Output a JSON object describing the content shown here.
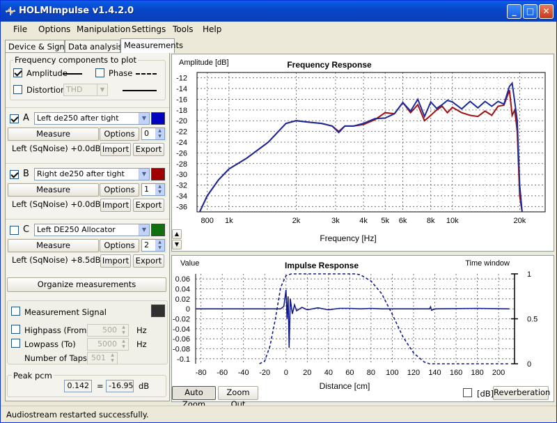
{
  "window": {
    "title": "HOLMImpulse  v1.4.2.0",
    "minimize": "_",
    "maximize": "□",
    "close": "✕"
  },
  "menu": [
    "File",
    "Options",
    "Manipulation",
    "Settings",
    "Tools",
    "Help"
  ],
  "tabs": [
    "Device & Signal",
    "Data analysis",
    "Measurements"
  ],
  "components": {
    "group_label": "Frequency components to plot",
    "amplitude": "Amplitude",
    "phase": "Phase",
    "distortion": "Distortion",
    "distortion_type": "THD",
    "amplitude_checked": true,
    "phase_checked": false,
    "distortion_checked": false
  },
  "measurements": [
    {
      "letter": "A",
      "name": "Left de250 after tight",
      "color": "#0000c0",
      "checked": true,
      "measure": "Measure",
      "options": "Options",
      "index": "0",
      "status": "Left (SqNoise) +0.0dB",
      "import": "Import",
      "export": "Export"
    },
    {
      "letter": "B",
      "name": "Right de250 after tight",
      "color": "#a00000",
      "checked": true,
      "measure": "Measure",
      "options": "Options",
      "index": "1",
      "status": "Left (SqNoise) +0.0dB",
      "import": "Import",
      "export": "Export"
    },
    {
      "letter": "C",
      "name": "Left DE250 Allocator",
      "color": "#107010",
      "checked": false,
      "measure": "Measure",
      "options": "Options",
      "index": "2",
      "status": "Left (SqNoise) +8.5dB",
      "import": "Import",
      "export": "Export"
    }
  ],
  "organize": "Organize measurements",
  "signal": {
    "label": "Measurement Signal",
    "color": "#303030",
    "highpass": "Highpass (From)",
    "highpass_value": "500",
    "hz1": "Hz",
    "lowpass": "Lowpass (To)",
    "lowpass_value": "5000",
    "hz2": "Hz",
    "taps_label": "Number of Taps",
    "taps_value": "501"
  },
  "peak": {
    "label": "Peak pcm",
    "value1": "0.142",
    "eq": "=",
    "value2": "-16.95",
    "unit": "dB"
  },
  "freq_plot": {
    "ylabel": "Amplitude [dB]",
    "title": "Frequency Response",
    "xlabel": "Frequency [Hz]",
    "yticks": [
      "-12",
      "-14",
      "-16",
      "-18",
      "-20",
      "-22",
      "-24",
      "-26",
      "-28",
      "-30",
      "-32",
      "-34",
      "-36"
    ],
    "xticks": [
      "800",
      "1k",
      "2k",
      "3k",
      "4k",
      "5k",
      "6k",
      "8k",
      "10k",
      "20k"
    ]
  },
  "imp_plot": {
    "ylabel": "Value",
    "title": "Impulse Response",
    "rlabel": "Time window",
    "xlabel": "Distance [cm]",
    "yticks": [
      "0.06",
      "0.04",
      "0.02",
      "0",
      "-0.02",
      "-0.04",
      "-0.06",
      "-0.08",
      "-0.1"
    ],
    "rticks": [
      "1",
      "0.5",
      "0"
    ],
    "xticks": [
      "-80",
      "-60",
      "-40",
      "-20",
      "0",
      "20",
      "40",
      "60",
      "80",
      "100",
      "120",
      "140",
      "160",
      "180",
      "200"
    ]
  },
  "controls": {
    "auto_zoom": "Auto Zoom",
    "zoom_out": "Zoom Out",
    "db": "[dB]",
    "reverb": "Reverberation",
    "up": "▲",
    "down": "▼"
  },
  "status": "Audiostream restarted successfully.",
  "chart_data": [
    {
      "type": "line",
      "title": "Frequency Response",
      "xlabel": "Frequency [Hz]",
      "ylabel": "Amplitude [dB]",
      "xscale": "log",
      "xlim": [
        720,
        26000
      ],
      "ylim": [
        -37,
        -11
      ],
      "grid": true,
      "series": [
        {
          "color": "#1a2a9c",
          "x": [
            740,
            800,
            900,
            1000,
            1200,
            1500,
            1800,
            2000,
            2300,
            2600,
            2900,
            3100,
            3300,
            3600,
            4000,
            4500,
            5000,
            5500,
            6000,
            6500,
            7000,
            7500,
            8000,
            8500,
            9000,
            9500,
            10000,
            11000,
            12000,
            13000,
            14000,
            15000,
            16000,
            17000,
            18000,
            18500,
            19000,
            19500,
            20000,
            20500
          ],
          "y": [
            -37,
            -34,
            -31,
            -29,
            -27,
            -24,
            -20.5,
            -20,
            -20.3,
            -20.5,
            -21,
            -22.2,
            -21,
            -21,
            -20.5,
            -19.6,
            -19.5,
            -18.7,
            -16.6,
            -18.2,
            -16,
            -19.2,
            -16.5,
            -17.7,
            -17,
            -16.2,
            -16.5,
            -17.8,
            -16.4,
            -17.6,
            -16.4,
            -17.3,
            -16.4,
            -16.9,
            -13.6,
            -13,
            -16.5,
            -20,
            -32,
            -37
          ]
        },
        {
          "color": "#a01010",
          "x": [
            740,
            800,
            900,
            1000,
            1200,
            1500,
            1800,
            2000,
            2300,
            2600,
            2900,
            3100,
            3300,
            3600,
            4000,
            4500,
            5000,
            5500,
            6000,
            6500,
            7000,
            7500,
            8000,
            8500,
            9000,
            9500,
            10000,
            11000,
            12000,
            13000,
            14000,
            15000,
            16000,
            17000,
            18000,
            18500,
            19000,
            19500,
            20000,
            20500
          ],
          "y": [
            -37,
            -34,
            -31,
            -29,
            -27,
            -24,
            -20.5,
            -20,
            -20.3,
            -20.5,
            -21,
            -22,
            -21,
            -21,
            -20.7,
            -19.8,
            -18.5,
            -18.7,
            -16.6,
            -18.5,
            -17,
            -20,
            -19,
            -18,
            -17.3,
            -18.5,
            -17.5,
            -18.5,
            -19,
            -19.2,
            -18.2,
            -19,
            -17.3,
            -17.1,
            -14.3,
            -19,
            -18,
            -22,
            -34,
            -37
          ]
        }
      ]
    },
    {
      "type": "line",
      "title": "Impulse Response",
      "xlabel": "Distance [cm]",
      "ylabel": "Value",
      "y2label": "Time window",
      "xlim": [
        -85,
        215
      ],
      "ylim": [
        -0.11,
        0.07
      ],
      "y2lim": [
        0,
        1
      ],
      "grid": true,
      "series": [
        {
          "color": "#101a8a",
          "x": [
            -85,
            -5,
            -2,
            0,
            1,
            2,
            3,
            4,
            6,
            8,
            10,
            15,
            20,
            30,
            40,
            50,
            60,
            70,
            80,
            90,
            100,
            135,
            136,
            137,
            140,
            180,
            210
          ],
          "y": [
            0,
            0,
            0.005,
            0.038,
            -0.02,
            0.025,
            -0.078,
            0.02,
            -0.01,
            0.008,
            -0.004,
            0.003,
            -0.002,
            0.002,
            -0.002,
            0.001,
            0.001,
            0,
            0.001,
            0,
            0,
            0,
            0.004,
            -0.003,
            0,
            0.001,
            0
          ]
        },
        {
          "color": "#101a8a",
          "dash": true,
          "axis": "y2",
          "x": [
            -25,
            -20,
            -15,
            -10,
            -5,
            0,
            5,
            65,
            70,
            80,
            90,
            100,
            110,
            120,
            130,
            135,
            210
          ],
          "y": [
            0,
            0.03,
            0.2,
            0.5,
            0.85,
            0.98,
            1,
            1,
            0.99,
            0.92,
            0.78,
            0.55,
            0.3,
            0.12,
            0.02,
            0,
            0
          ]
        }
      ]
    }
  ]
}
